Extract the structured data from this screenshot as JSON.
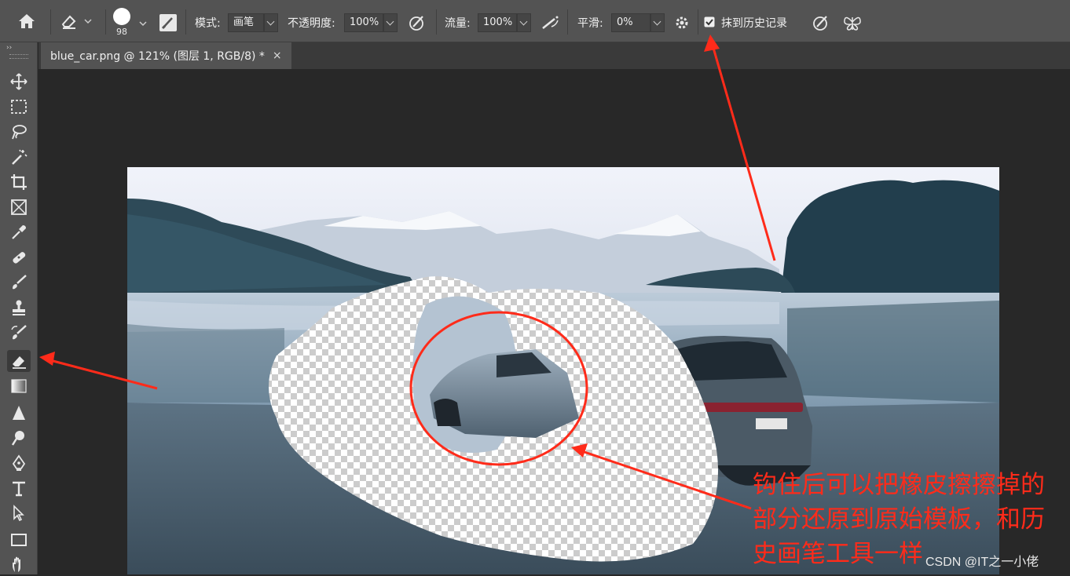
{
  "options": {
    "brush_size": "98",
    "mode_label": "模式:",
    "mode_value": "画笔",
    "opacity_label": "不透明度:",
    "opacity_value": "100%",
    "flow_label": "流量:",
    "flow_value": "100%",
    "smooth_label": "平滑:",
    "smooth_value": "0%",
    "history_label": "抹到历史记录",
    "history_checked": true
  },
  "tab": {
    "title": "blue_car.png @ 121% (图层 1, RGB/8) *",
    "close": "×"
  },
  "tools": [
    "move",
    "marquee",
    "lasso",
    "magic-wand",
    "crop",
    "frame",
    "eyedropper",
    "healing",
    "brush",
    "stamp",
    "history-brush",
    "eraser",
    "gradient",
    "sharpen",
    "dodge",
    "pen",
    "type",
    "path-select",
    "rectangle",
    "hand"
  ],
  "active_tool": "eraser",
  "annotation": {
    "line1": "钩住后可以把橡皮擦擦掉的",
    "line2": "部分还原到原始模板，和历",
    "line3": "史画笔工具一样"
  },
  "watermark": "CSDN @IT之一小佬",
  "colors": {
    "accent_red": "#ff2b1a",
    "panel": "#535353",
    "workspace": "#282828"
  }
}
